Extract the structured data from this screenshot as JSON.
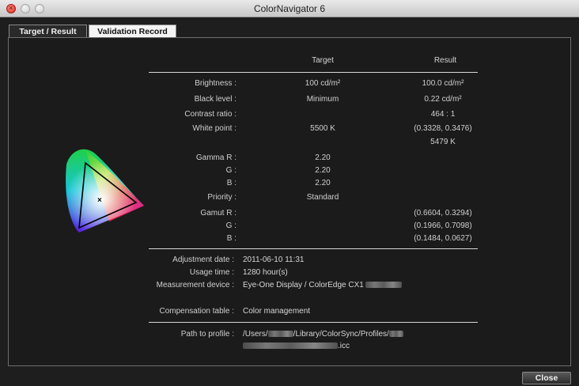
{
  "window": {
    "title": "ColorNavigator 6"
  },
  "tabs": [
    {
      "label": "Target / Result",
      "active": true
    },
    {
      "label": "Validation Record",
      "active": false
    }
  ],
  "columns": {
    "target": "Target",
    "result": "Result"
  },
  "rows": {
    "brightness": {
      "label": "Brightness :",
      "target": "100 cd/m²",
      "result": "100.0 cd/m²"
    },
    "black_level": {
      "label": "Black level :",
      "target": "Minimum",
      "result": "0.22 cd/m²"
    },
    "contrast": {
      "label": "Contrast ratio :",
      "target": "",
      "result": "464 : 1"
    },
    "white_point": {
      "label": "White point :",
      "target": "5500 K",
      "result": "(0.3328, 0.3476)",
      "result2": "5479 K"
    },
    "gamma_r": {
      "label": "Gamma R :",
      "target": "2.20"
    },
    "gamma_g": {
      "label": "G :",
      "target": "2.20"
    },
    "gamma_b": {
      "label": "B :",
      "target": "2.20"
    },
    "priority": {
      "label": "Priority :",
      "target": "Standard"
    },
    "gamut_r": {
      "label": "Gamut R :",
      "result": "(0.6604, 0.3294)"
    },
    "gamut_g": {
      "label": "G :",
      "result": "(0.1966, 0.7098)"
    },
    "gamut_b": {
      "label": "B :",
      "result": "(0.1484, 0.0627)"
    }
  },
  "info": {
    "adjustment_date_label": "Adjustment date :",
    "adjustment_date": "2011-06-10 11:31",
    "usage_time_label": "Usage time :",
    "usage_time": "1280 hour(s)",
    "device_label": "Measurement device :",
    "device": "Eye-One Display / ColorEdge CX1",
    "compensation_label": "Compensation table :",
    "compensation": "Color management",
    "profile_label": "Path to profile :",
    "profile_part1": "/Users/",
    "profile_part2": "/Library/ColorSync/Profiles/",
    "profile_ext": ".icc"
  },
  "buttons": {
    "close": "Close"
  }
}
